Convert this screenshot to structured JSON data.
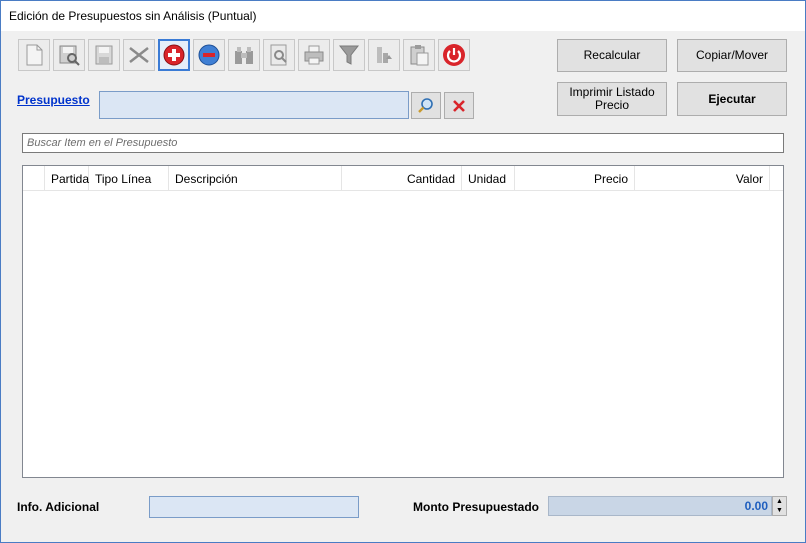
{
  "window": {
    "title": "Edición de Presupuestos sin Análisis (Puntual)"
  },
  "toolbar": {
    "icons": [
      "new-document-icon",
      "search-save-icon",
      "save-icon",
      "cut-icon",
      "add-icon",
      "remove-icon",
      "binoculars-icon",
      "preview-icon",
      "print-icon",
      "filter-icon",
      "export-icon",
      "paste-icon",
      "power-icon"
    ]
  },
  "buttons": {
    "recalcular": "Recalcular",
    "copiar_mover": "Copiar/Mover",
    "imprimir_line1": "Imprimir Listado",
    "imprimir_line2": "Precio",
    "ejecutar": "Ejecutar"
  },
  "presupuesto": {
    "label": "Presupuesto",
    "value": ""
  },
  "search": {
    "placeholder": "Buscar Item en el Presupuesto"
  },
  "grid": {
    "columns": [
      "Partida",
      "Tipo Línea",
      "Descripción",
      "Cantidad",
      "Unidad",
      "Precio",
      "Valor"
    ],
    "rows": []
  },
  "footer": {
    "info_label": "Info. Adicional",
    "info_value": "",
    "monto_label": "Monto Presupuestado",
    "monto_value": "0.00"
  },
  "colors": {
    "field_bg": "#dbe6f4",
    "link": "#0033cc",
    "monto_text": "#1f5fbf"
  }
}
